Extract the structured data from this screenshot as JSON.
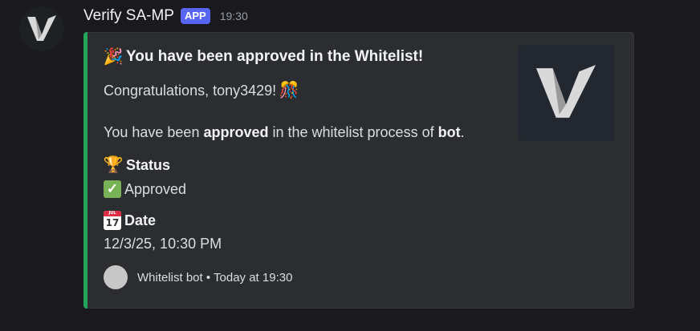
{
  "message": {
    "author": "Verify SA-MP",
    "badge": "APP",
    "time": "19:30"
  },
  "embed": {
    "accent_color": "#23a55a",
    "title": "You have been approved in the Whitelist!",
    "title_emoji": "party-popper",
    "greeting": "Congratulations, tony3429!",
    "greeting_emoji": "confetti-ball",
    "body_prefix": "You have been ",
    "body_bold1": "approved",
    "body_mid": " in the whitelist process of ",
    "body_bold2": "bot",
    "body_suffix": ".",
    "fields": [
      {
        "name": "Status",
        "name_emoji": "trophy",
        "value": "Approved",
        "value_emoji": "check-mark-button"
      },
      {
        "name": "Date",
        "name_emoji": "calendar",
        "value": "12/3/25, 10:30 PM"
      }
    ],
    "footer": "Whitelist bot • Today at 19:30"
  }
}
